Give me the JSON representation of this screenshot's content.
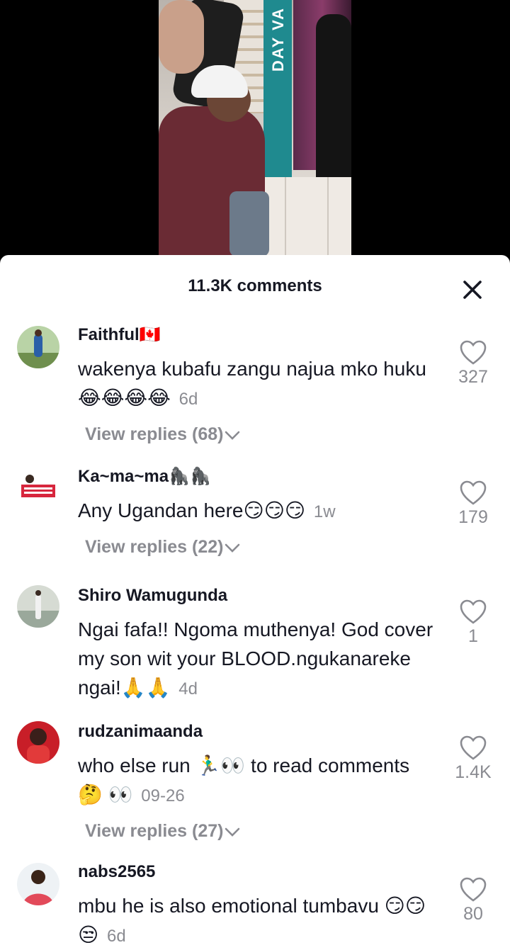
{
  "video": {
    "banner_text": "DAY VA"
  },
  "sheet": {
    "title": "11.3K comments",
    "close_icon": "close-icon"
  },
  "comments": [
    {
      "user": "Faithful🇨🇦",
      "text": "wakenya kubafu zangu najua mko huku😂😂😂😂",
      "time": "6d",
      "likes": "327",
      "replies": "View replies (68)",
      "avatar_color": "#6f8f4e"
    },
    {
      "user": "Ka~ma~ma🦍🦍",
      "text": "Any Ugandan here😏😏😏",
      "time": "1w",
      "likes": "179",
      "replies": "View replies (22)",
      "avatar_color": "#d7263d"
    },
    {
      "user": "Shiro Wamugunda",
      "text": "Ngai fafa!! Ngoma muthenya! God cover my son wit your BLOOD.ngukanareke ngai!🙏🙏",
      "time": "4d",
      "likes": "1",
      "replies": "",
      "avatar_color": "#9aa89b"
    },
    {
      "user": "rudzanimaanda",
      "text": "who else run 🏃‍♂️👀 to read comments 🤔 👀",
      "time": "09-26",
      "likes": "1.4K",
      "replies": "View replies (27)",
      "avatar_color": "#c81e28"
    },
    {
      "user": "nabs2565",
      "text": "mbu he is also emotional tumbavu 😏😏😒",
      "time": "6d",
      "likes": "80",
      "replies": "",
      "avatar_color": "#e24a5a"
    }
  ]
}
